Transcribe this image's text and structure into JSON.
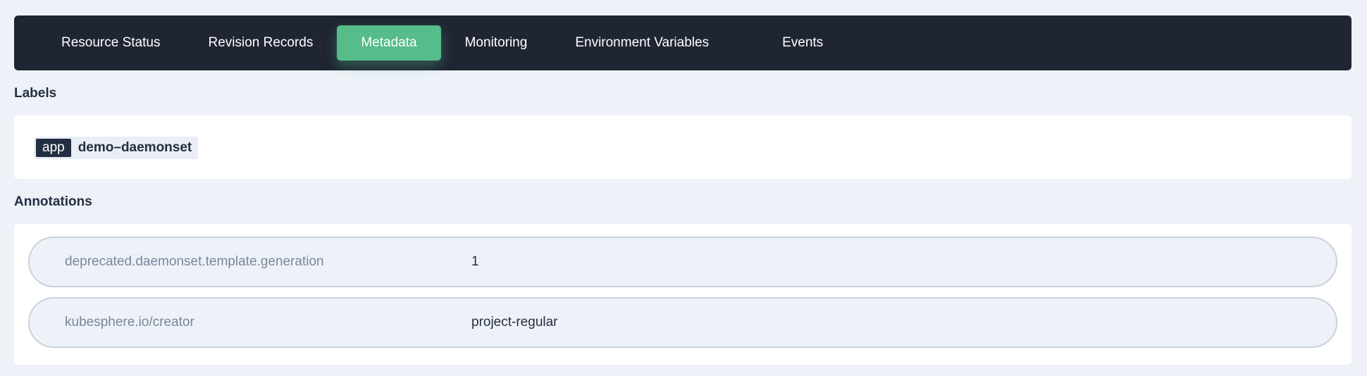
{
  "tabs": [
    {
      "label": "Resource Status",
      "active": false
    },
    {
      "label": "Revision Records",
      "active": false
    },
    {
      "label": "Metadata",
      "active": true
    },
    {
      "label": "Monitoring",
      "active": false
    },
    {
      "label": "Environment Variables",
      "active": false
    },
    {
      "label": "Events",
      "active": false
    }
  ],
  "labels_section": {
    "title": "Labels",
    "items": [
      {
        "key": "app",
        "value": "demo–daemonset"
      }
    ]
  },
  "annotations_section": {
    "title": "Annotations",
    "rows": [
      {
        "key": "deprecated.daemonset.template.generation",
        "value": "1"
      },
      {
        "key": "kubesphere.io/creator",
        "value": "project-regular"
      }
    ]
  },
  "colors": {
    "tabbar_bg": "#1f2533",
    "active_tab": "#55bc8a",
    "page_bg": "#eef2f8",
    "label_key_bg": "#242e42"
  }
}
